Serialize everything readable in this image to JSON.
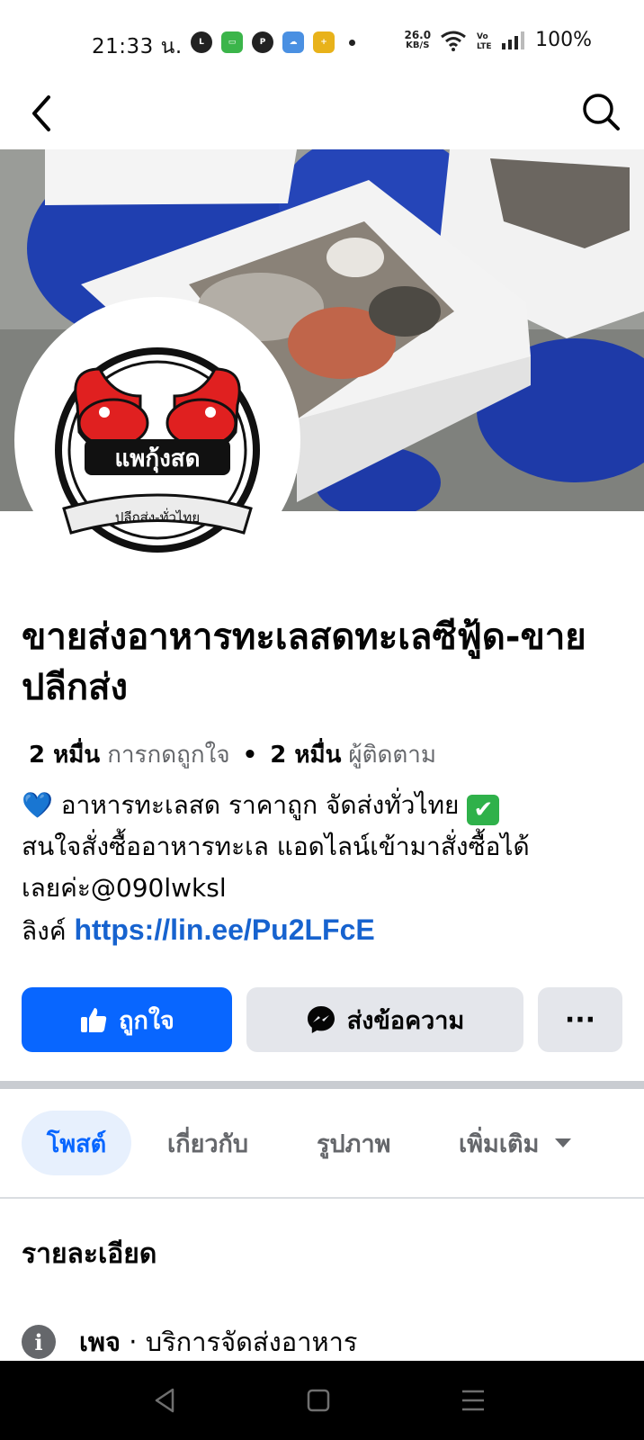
{
  "status_bar": {
    "time": "21:33 น.",
    "notification_apps": [
      "line-icon",
      "messages-icon",
      "pinterest-icon",
      "weather-icon",
      "app-plus-icon"
    ],
    "net_speed_value": "26.0",
    "net_speed_unit": "KB/S",
    "battery": "100%"
  },
  "header": {
    "back_icon": "chevron-left-icon",
    "search_icon": "search-icon"
  },
  "profile": {
    "avatar_logo_text": "แพกุ้งสด",
    "avatar_banner_text": "ปลีกส่ง-ทั่วไทย",
    "title": "ขายส่งอาหารทะเลสดทะเลซีฟู้ด-ขายปลีกส่ง",
    "likes_count": "2 หมื่น",
    "likes_label": "การกดถูกใจ",
    "separator": "•",
    "followers_count": "2 หมื่น",
    "followers_label": "ผู้ติดตาม"
  },
  "bio": {
    "line1_emoji": "💙",
    "line1_text": "อาหารทะเลสด ราคาถูก จัดส่งทั่วไทย",
    "line1_check": "✔",
    "line2_text": "สนใจสั่งซื้ออาหารทะเล แอดไลน์เข้ามาสั่งซื้อได้",
    "line3_text": "เลยค่ะ@090lwksl",
    "link_prefix": "ลิงค์",
    "link_text": "https://lin.ee/Pu2LFcE"
  },
  "actions": {
    "like_label": "ถูกใจ",
    "message_label": "ส่งข้อความ",
    "more_label": "···"
  },
  "tabs": {
    "posts": "โพสต์",
    "about": "เกี่ยวกับ",
    "photos": "รูปภาพ",
    "more": "เพิ่มเติม"
  },
  "details": {
    "title": "รายละเอียด",
    "info_icon_glyph": "i",
    "page_label": "เพจ",
    "page_sep": "·",
    "page_category": "บริการจัดส่งอาหาร"
  },
  "colors": {
    "primary": "#0866ff",
    "link": "#1763cf",
    "secondary_text": "#65676b",
    "button_gray": "#e4e6eb",
    "tab_active_bg": "#e7f0fd",
    "logo_red": "#e02020"
  }
}
